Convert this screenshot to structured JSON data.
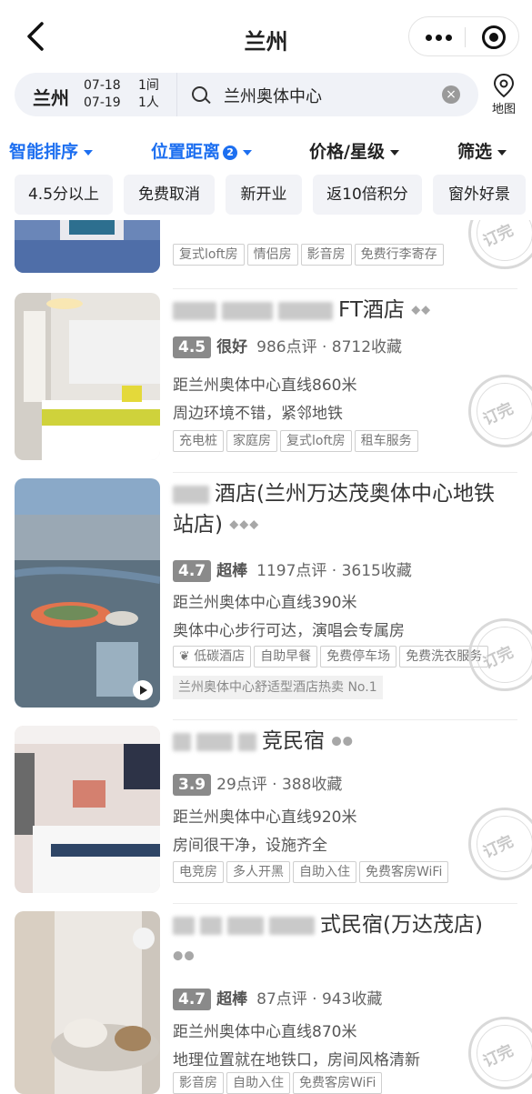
{
  "header": {
    "title": "兰州"
  },
  "search": {
    "city": "兰州",
    "checkin": "07-18",
    "checkout": "07-19",
    "rooms": "1间",
    "guests": "1人",
    "query": "兰州奥体中心",
    "map_label": "地图"
  },
  "sort": {
    "smart": "智能排序",
    "distance": "位置距离",
    "distance_badge": "2",
    "price": "价格/星级",
    "filter": "筛选"
  },
  "chips": [
    "4.5分以上",
    "免费取消",
    "新开业",
    "返10倍积分",
    "窗外好景"
  ],
  "stamp_text": "订完",
  "hotels": [
    {
      "name": "",
      "tags": [
        "复式loft房",
        "情侣房",
        "影音房",
        "免费行李寄存"
      ]
    },
    {
      "name_suffix": "FT酒店",
      "diamonds": "◆◆",
      "score": "4.5",
      "grade": "很好",
      "reviews_favs": "986点评 · 8712收藏",
      "distance": "距兰州奥体中心直线860米",
      "highlight": "周边环境不错，紧邻地铁",
      "tags": [
        "充电桩",
        "家庭房",
        "复式loft房",
        "租车服务"
      ]
    },
    {
      "name_suffix": "酒店(兰州万达茂奥体中心地铁站店)",
      "diamonds": "◆◆◆",
      "score": "4.7",
      "grade": "超棒",
      "reviews_favs": "1197点评 · 3615收藏",
      "distance": "距兰州奥体中心直线390米",
      "highlight": "奥体中心步行可达，演唱会专属房",
      "tags": [
        "低碳酒店",
        "自助早餐",
        "免费停车场",
        "免费洗衣服务"
      ],
      "rank": "兰州奥体中心舒适型酒店热卖 No.1"
    },
    {
      "name_suffix": "竞民宿",
      "diamonds": "●●",
      "score": "3.9",
      "reviews_favs": "29点评 · 388收藏",
      "distance": "距兰州奥体中心直线920米",
      "highlight": "房间很干净，设施齐全",
      "tags": [
        "电竞房",
        "多人开黑",
        "自助入住",
        "免费客房WiFi"
      ]
    },
    {
      "name_suffix": "式民宿(万达茂店)",
      "diamonds": "●●",
      "score": "4.7",
      "grade": "超棒",
      "reviews_favs": "87点评 · 943收藏",
      "distance": "距兰州奥体中心直线870米",
      "highlight": "地理位置就在地铁口，房间风格清新",
      "tags": [
        "影音房",
        "自助入住",
        "免费客房WiFi"
      ]
    }
  ]
}
